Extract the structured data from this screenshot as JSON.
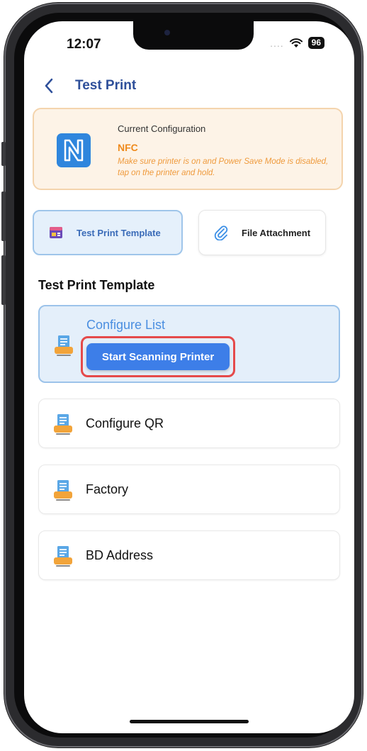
{
  "status": {
    "time": "12:07",
    "signal": "....",
    "battery": "96"
  },
  "nav": {
    "title": "Test Print"
  },
  "config": {
    "label": "Current Configuration",
    "value": "NFC",
    "description": "Make sure printer is on and Power Save Mode is disabled, tap on the printer and hold."
  },
  "tabs": [
    {
      "label": "Test Print Template",
      "active": true
    },
    {
      "label": "File Attachment",
      "active": false
    }
  ],
  "section_title": "Test Print Template",
  "items": [
    {
      "label": "Configure List",
      "selected": true
    },
    {
      "label": "Configure QR",
      "selected": false
    },
    {
      "label": "Factory",
      "selected": false
    },
    {
      "label": "BD Address",
      "selected": false
    }
  ],
  "scan_button": {
    "label": "Start Scanning Printer"
  },
  "colors": {
    "accent": "#3d7ee8",
    "title": "#2e4f9a",
    "warning": "#ef8a1c",
    "highlight": "#e54a4a"
  }
}
